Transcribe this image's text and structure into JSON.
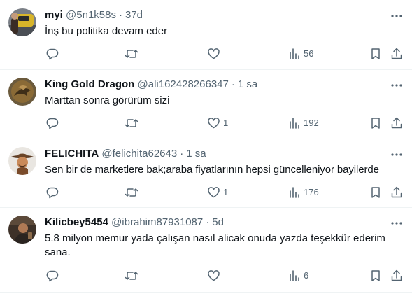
{
  "tweets": [
    {
      "name": "myi",
      "handle": "@5n1k58s",
      "time": "37d",
      "text": "İnş bu politika devam eder",
      "reply_count": "",
      "retweet_count": "",
      "like_count": "",
      "view_count": "56",
      "avatar": "photo-car"
    },
    {
      "name": "King Gold Dragon",
      "handle": "@ali162428266347",
      "time": "1 sa",
      "text": "Marttan sonra görürüm sizi",
      "reply_count": "",
      "retweet_count": "",
      "like_count": "1",
      "view_count": "192",
      "avatar": "photo-dragon"
    },
    {
      "name": "FELICHITA",
      "handle": "@felichita62643",
      "time": "1 sa",
      "text": "Sen bir de marketlere bak;araba fiyatlarının hepsi güncelleniyor bayilerde",
      "reply_count": "",
      "retweet_count": "",
      "like_count": "1",
      "view_count": "176",
      "avatar": "cartoon-cowboy"
    },
    {
      "name": "Kilicbey5454",
      "handle": "@ibrahim87931087",
      "time": "5d",
      "text": "5.8 milyon memur yada çalışan nasıl alicak onuda yazda teşekkür ederim sana.",
      "reply_count": "",
      "retweet_count": "",
      "like_count": "",
      "view_count": "6",
      "avatar": "photo-person"
    }
  ],
  "colors": {
    "text_primary": "#0f1419",
    "text_secondary": "#536471",
    "divider": "#eff3f4"
  },
  "icons": [
    "reply-icon",
    "retweet-icon",
    "like-icon",
    "views-icon",
    "bookmark-icon",
    "share-icon",
    "more-icon"
  ]
}
